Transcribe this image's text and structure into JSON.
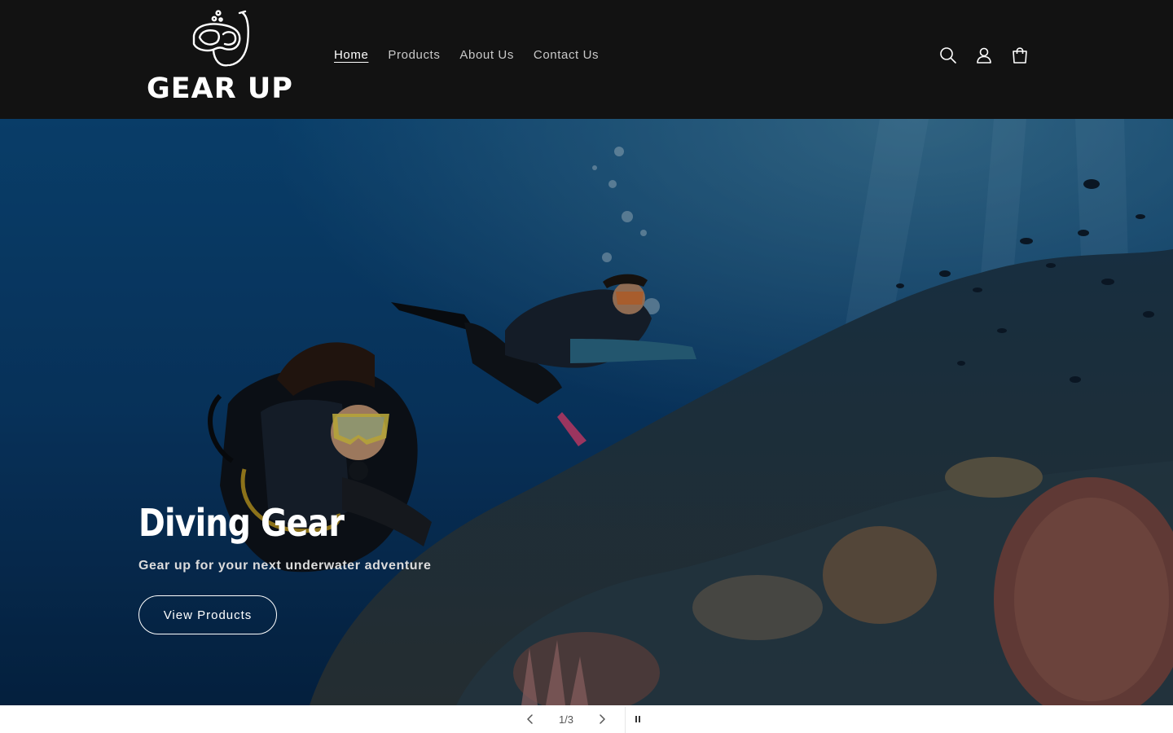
{
  "header": {
    "logo_text": "GEAR UP",
    "nav": [
      {
        "label": "Home",
        "active": true
      },
      {
        "label": "Products",
        "active": false
      },
      {
        "label": "About Us",
        "active": false
      },
      {
        "label": "Contact Us",
        "active": false
      }
    ],
    "icons": [
      "search-icon",
      "account-icon",
      "cart-icon"
    ]
  },
  "hero": {
    "title": "Diving Gear",
    "subtitle": "Gear up for your next underwater adventure",
    "button_label": "View Products"
  },
  "slider": {
    "counter": "1/3",
    "controls": [
      "chevron-left-icon",
      "chevron-right-icon",
      "pause-icon"
    ]
  },
  "colors": {
    "header_bg": "#121212",
    "text_light": "#ffffff",
    "ocean_deep": "#062a55",
    "ocean_mid": "#0c4f86"
  }
}
